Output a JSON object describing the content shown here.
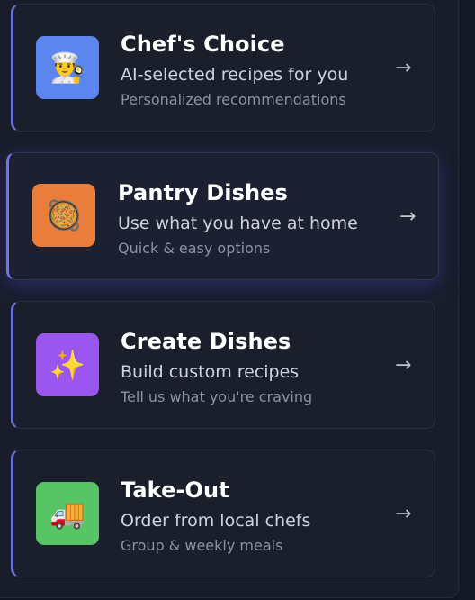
{
  "options": [
    {
      "title": "Chef's Choice",
      "description": "AI-selected recipes for you",
      "subtitle": "Personalized recommendations",
      "icon": "chef-icon",
      "emoji": "👨‍🍳",
      "tile_color": "#5b86ef",
      "arrow": "→"
    },
    {
      "title": "Pantry Dishes",
      "description": "Use what you have at home",
      "subtitle": "Quick & easy options",
      "icon": "paella-pan-icon",
      "emoji": "🥘",
      "tile_color": "#ea7d3a",
      "arrow": "→"
    },
    {
      "title": "Create Dishes",
      "description": "Build custom recipes",
      "subtitle": "Tell us what you're craving",
      "icon": "sparkles-icon",
      "emoji": "✨",
      "tile_color": "#9a56ef",
      "arrow": "→"
    },
    {
      "title": "Take-Out",
      "description": "Order from local chefs",
      "subtitle": "Group & weekly meals",
      "icon": "delivery-truck-icon",
      "emoji": "🚚",
      "tile_color": "#57c466",
      "arrow": "→"
    }
  ],
  "colors": {
    "background": "#121524",
    "card": "#1b1f2c",
    "accent": "#6a70d6"
  }
}
